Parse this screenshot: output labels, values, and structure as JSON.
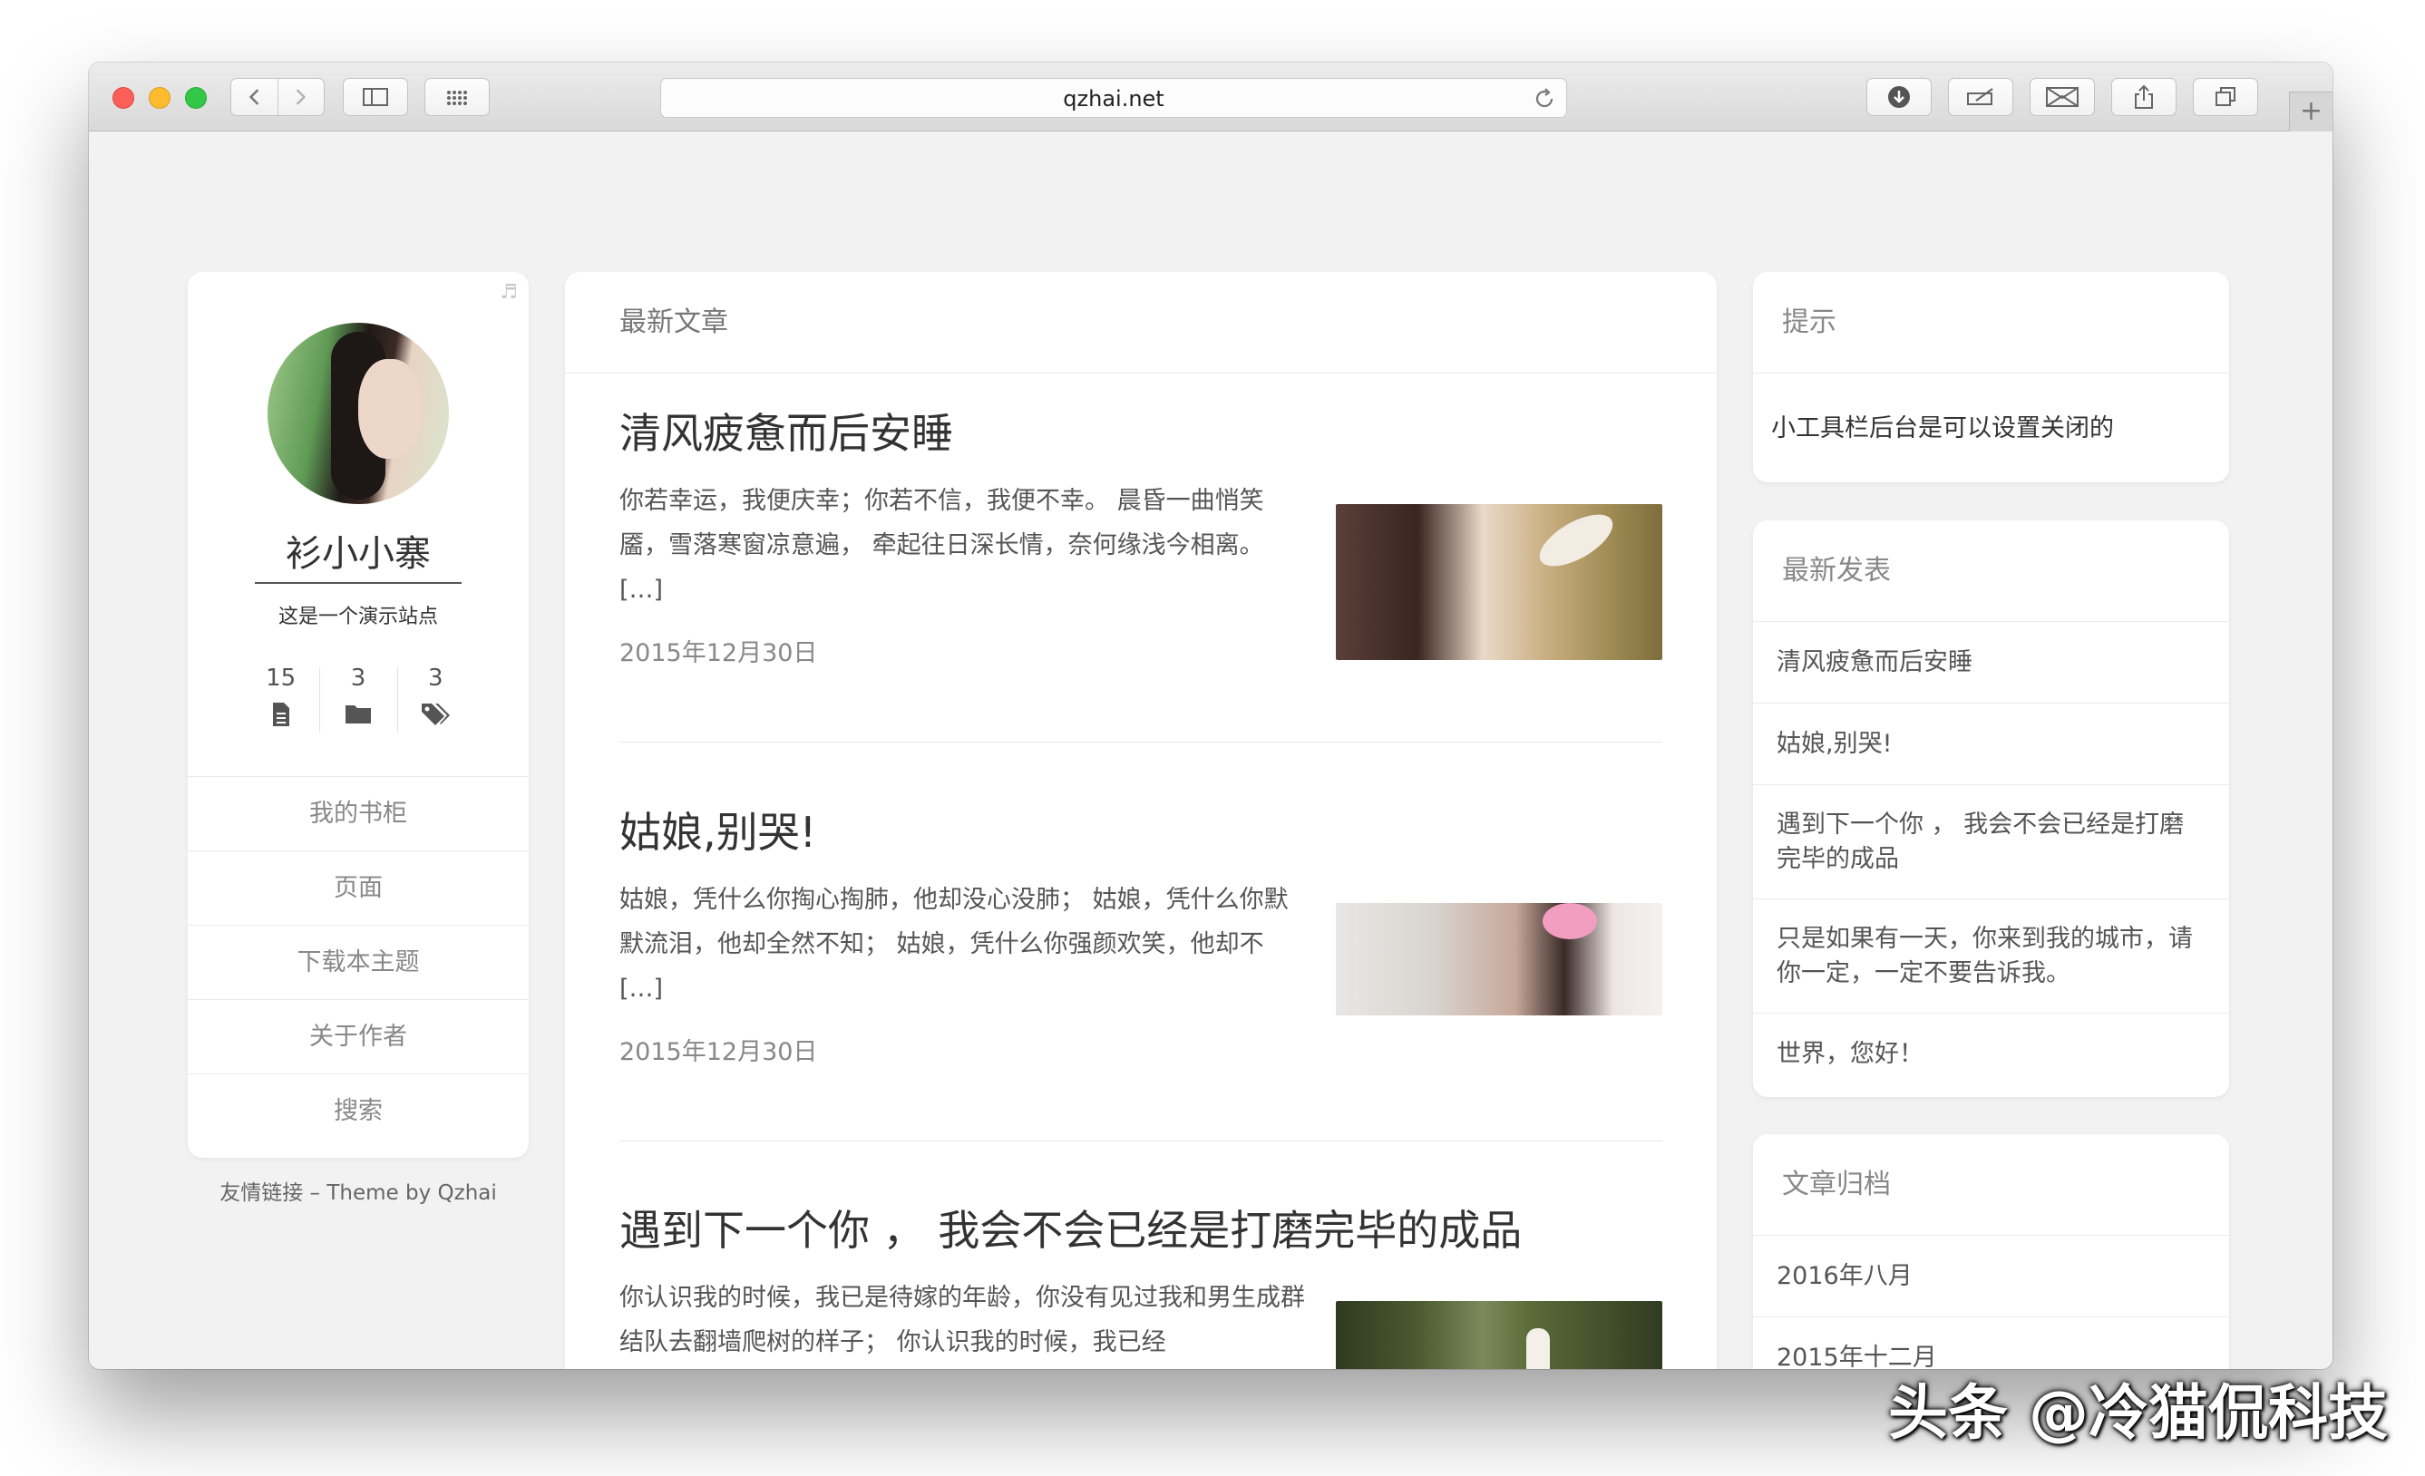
{
  "browser": {
    "url": "qzhai.net"
  },
  "profile": {
    "name": "衫小小寨",
    "description": "这是一个演示站点",
    "stats": [
      {
        "count": "15",
        "icon": "file-icon"
      },
      {
        "count": "3",
        "icon": "folder-icon"
      },
      {
        "count": "3",
        "icon": "tags-icon"
      }
    ],
    "menu": [
      "我的书柜",
      "页面",
      "下载本主题",
      "关于作者",
      "搜索"
    ],
    "credits": "友情链接 – Theme by Qzhai"
  },
  "main": {
    "heading": "最新文章",
    "posts": [
      {
        "title": "清风疲惫而后安睡",
        "excerpt": "你若幸运，我便庆幸；你若不信，我便不幸。 晨昏一曲悄笑靥，雪落寒窗凉意遍， 牵起往日深长情，奈何缘浅今相离。 […]",
        "date": "2015年12月30日"
      },
      {
        "title": "姑娘,别哭!",
        "excerpt": "姑娘，凭什么你掏心掏肺，他却没心没肺； 姑娘，凭什么你默默流泪，他却全然不知； 姑娘，凭什么你强颜欢笑，他却不 […]",
        "date": "2015年12月30日"
      },
      {
        "title": "遇到下一个你 ， 我会不会已经是打磨完毕的成品",
        "excerpt": "你认识我的时候，我已是待嫁的年龄，你没有见过我和男生成群结队去翻墙爬树的样子； 你认识我的时候，我已经",
        "date": ""
      }
    ]
  },
  "sidebar": {
    "tip": {
      "heading": "提示",
      "text": "小工具栏后台是可以设置关闭的"
    },
    "recent": {
      "heading": "最新发表",
      "items": [
        "清风疲惫而后安睡",
        "姑娘,别哭!",
        "遇到下一个你 ， 我会不会已经是打磨完毕的成品",
        "只是如果有一天，你来到我的城市，请你一定，一定不要告诉我。",
        "世界，您好！"
      ]
    },
    "archive": {
      "heading": "文章归档",
      "items": [
        "2016年八月",
        "2015年十二月"
      ]
    }
  },
  "watermark": "头条 @冷猫侃科技"
}
